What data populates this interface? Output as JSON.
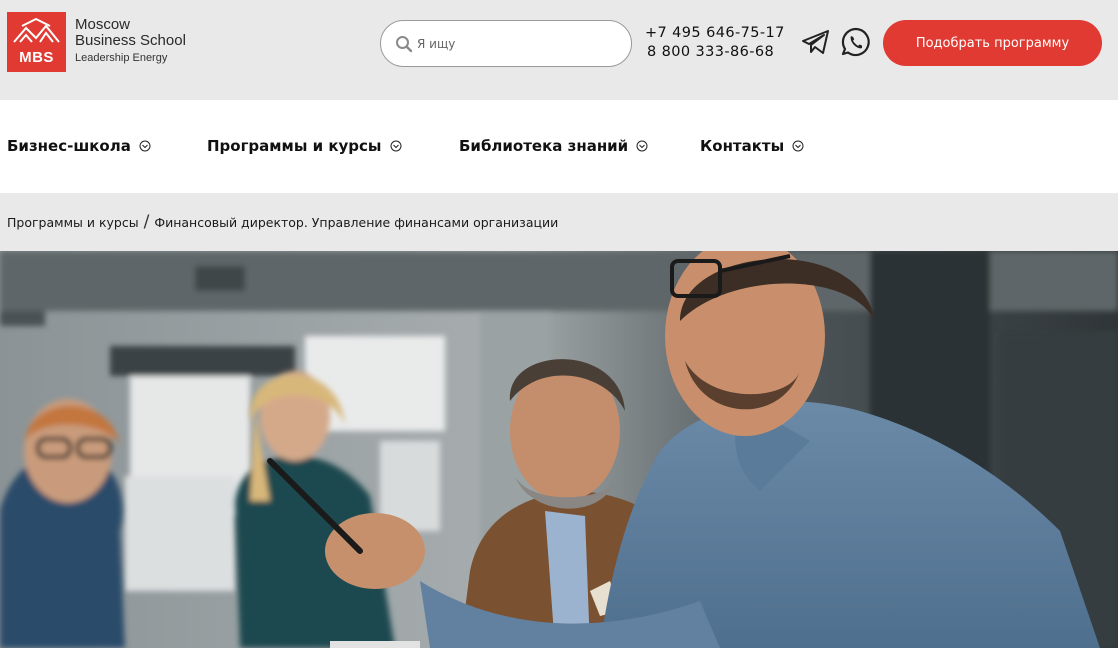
{
  "brand": {
    "abbr": "MBS",
    "name_line1": "Moscow",
    "name_line2": "Business School",
    "tagline": "Leadership Energy",
    "color": "#e03a32"
  },
  "search": {
    "placeholder": "Я ищу"
  },
  "contacts": {
    "phone1": "+7 495 646-75-17",
    "phone2": "8 800 333-86-68"
  },
  "social": [
    "telegram-icon",
    "whatsapp-icon"
  ],
  "cta": {
    "label": "Подобрать программу"
  },
  "nav": {
    "items": [
      {
        "label": "Бизнес-школа"
      },
      {
        "label": "Программы и курсы"
      },
      {
        "label": "Библиотека знаний"
      },
      {
        "label": "Контакты"
      }
    ]
  },
  "breadcrumb": {
    "items": [
      {
        "label": "Программы и курсы"
      },
      {
        "label": "Финансовый директор. Управление финансами организации"
      }
    ],
    "separator": "/"
  },
  "hero": {
    "image": "photo of business meeting with four people"
  }
}
